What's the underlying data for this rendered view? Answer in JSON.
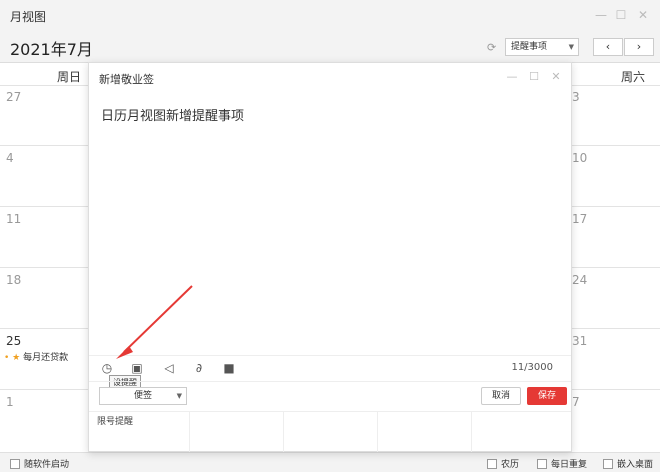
{
  "window": {
    "title": "月视图"
  },
  "header": {
    "month": "2021年7月",
    "filter_value": "提醒事项",
    "prev": "‹",
    "next": "›"
  },
  "calendar": {
    "columns": [
      "周日",
      "周六"
    ],
    "left_days": [
      "27",
      "4",
      "11",
      "18",
      "25",
      "1"
    ],
    "right_days": [
      "3",
      "10",
      "17",
      "24",
      "31",
      "7"
    ],
    "event": "每月还贷款"
  },
  "dialog": {
    "title": "新增敬业签",
    "content": "日历月视图新增提醒事项",
    "counter": "11/3000",
    "tooltip": "设提醒",
    "tag_value": "便签",
    "cancel_label": "取消",
    "save_label": "保存",
    "holiday": "限号提醒"
  },
  "footer": {
    "startup": "随软件启动",
    "lunar": "农历",
    "daily_repeat": "每日重复",
    "embed_desktop": "嵌入桌面"
  },
  "colors": {
    "accent": "#e53935",
    "event_dot": "#f0a020"
  }
}
